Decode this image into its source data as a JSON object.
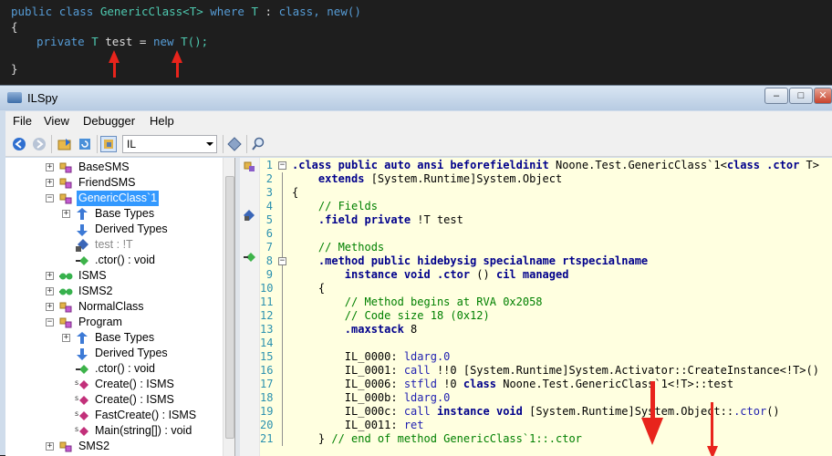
{
  "editor_snippet": {
    "line1": [
      "public",
      "class",
      "GenericClass<T>",
      "where",
      "T",
      ":",
      "class,",
      "new()"
    ],
    "line2": "{",
    "line3": [
      "private",
      "T",
      "test",
      "=",
      "new",
      "T();"
    ],
    "line4": "}"
  },
  "window": {
    "title": "ILSpy",
    "controls": [
      "–",
      "□",
      "✕"
    ]
  },
  "menu": {
    "file": "File",
    "view": "View",
    "debugger": "Debugger",
    "help": "Help"
  },
  "toolbar": {
    "language": "IL"
  },
  "tree": {
    "nodes": [
      {
        "label": "BaseSMS",
        "expander": "+",
        "icon": "class-icon"
      },
      {
        "label": "FriendSMS",
        "expander": "+",
        "icon": "class-icon"
      },
      {
        "label": "GenericClass`1",
        "expander": "−",
        "icon": "class-icon",
        "selected": true
      },
      {
        "label": "Base Types",
        "expander": "+",
        "icon": "base-types-icon"
      },
      {
        "label": "Derived Types",
        "expander": "",
        "icon": "derived-types-icon"
      },
      {
        "label": "test : !T",
        "expander": "",
        "icon": "field-icon",
        "gray": true
      },
      {
        "label": ".ctor() : void",
        "expander": "",
        "icon": "method-icon"
      },
      {
        "label": "ISMS",
        "expander": "+",
        "icon": "interface-icon"
      },
      {
        "label": "ISMS2",
        "expander": "+",
        "icon": "interface-icon"
      },
      {
        "label": "NormalClass",
        "expander": "+",
        "icon": "class-icon"
      },
      {
        "label": "Program",
        "expander": "−",
        "icon": "class-icon"
      },
      {
        "label": "Base Types",
        "expander": "+",
        "icon": "base-types-icon"
      },
      {
        "label": "Derived Types",
        "expander": "",
        "icon": "derived-types-icon"
      },
      {
        "label": ".ctor() : void",
        "expander": "",
        "icon": "method-icon"
      },
      {
        "label": "Create() : ISMS",
        "expander": "",
        "icon": "static-method-icon"
      },
      {
        "label": "Create() : ISMS",
        "expander": "",
        "icon": "static-method-icon"
      },
      {
        "label": "FastCreate() : ISMS",
        "expander": "",
        "icon": "static-method-icon"
      },
      {
        "label": "Main(string[]) : void",
        "expander": "",
        "icon": "static-method-icon"
      },
      {
        "label": "SMS2",
        "expander": "+",
        "icon": "class-icon"
      }
    ]
  },
  "code": {
    "lines": [
      {
        "n": "1",
        "parts": [
          [
            "k",
            ".class public auto ansi beforefieldinit "
          ],
          [
            "pl",
            "Noone.Test.GenericClass`1<"
          ],
          [
            "k",
            "class .ctor "
          ],
          [
            "pl",
            "T>"
          ]
        ]
      },
      {
        "n": "2",
        "parts": [
          [
            "pl",
            "    "
          ],
          [
            "k",
            "extends "
          ],
          [
            "pl",
            "[System.Runtime]System.Object"
          ]
        ]
      },
      {
        "n": "3",
        "parts": [
          [
            "pl",
            "{"
          ]
        ]
      },
      {
        "n": "4",
        "parts": [
          [
            "c",
            "    // Fields"
          ]
        ]
      },
      {
        "n": "5",
        "parts": [
          [
            "pl",
            "    "
          ],
          [
            "k",
            ".field private "
          ],
          [
            "pl",
            "!T test"
          ]
        ]
      },
      {
        "n": "6",
        "parts": [
          [
            "pl",
            ""
          ]
        ]
      },
      {
        "n": "7",
        "parts": [
          [
            "c",
            "    // Methods"
          ]
        ]
      },
      {
        "n": "8",
        "parts": [
          [
            "pl",
            "    "
          ],
          [
            "k",
            ".method public hidebysig specialname rtspecialname"
          ]
        ]
      },
      {
        "n": "9",
        "parts": [
          [
            "pl",
            "        "
          ],
          [
            "k",
            "instance void .ctor "
          ],
          [
            "pl",
            "() "
          ],
          [
            "k",
            "cil managed"
          ]
        ]
      },
      {
        "n": "10",
        "parts": [
          [
            "pl",
            "    {"
          ]
        ]
      },
      {
        "n": "11",
        "parts": [
          [
            "c",
            "        // Method begins at RVA 0x2058"
          ]
        ]
      },
      {
        "n": "12",
        "parts": [
          [
            "c",
            "        // Code size 18 (0x12)"
          ]
        ]
      },
      {
        "n": "13",
        "parts": [
          [
            "pl",
            "        "
          ],
          [
            "k",
            ".maxstack "
          ],
          [
            "pl",
            "8"
          ]
        ]
      },
      {
        "n": "14",
        "parts": [
          [
            "pl",
            ""
          ]
        ]
      },
      {
        "n": "15",
        "parts": [
          [
            "pl",
            "        IL_0000: "
          ],
          [
            "kb",
            "ldarg.0"
          ]
        ]
      },
      {
        "n": "16",
        "parts": [
          [
            "pl",
            "        IL_0001: "
          ],
          [
            "kb",
            "call "
          ],
          [
            "pl",
            "!!0 [System.Runtime]System.Activator::CreateInstance<!T>()"
          ]
        ]
      },
      {
        "n": "17",
        "parts": [
          [
            "pl",
            "        IL_0006: "
          ],
          [
            "kb",
            "stfld "
          ],
          [
            "pl",
            "!0 "
          ],
          [
            "k",
            "class "
          ],
          [
            "pl",
            "Noone.Test.GenericClass`1<!T>::test"
          ]
        ]
      },
      {
        "n": "18",
        "parts": [
          [
            "pl",
            "        IL_000b: "
          ],
          [
            "kb",
            "ldarg.0"
          ]
        ]
      },
      {
        "n": "19",
        "parts": [
          [
            "pl",
            "        IL_000c: "
          ],
          [
            "kb",
            "call "
          ],
          [
            "k",
            "instance void "
          ],
          [
            "pl",
            "[System.Runtime]System.Object::"
          ],
          [
            "kb",
            ".ctor"
          ],
          [
            "pl",
            "()"
          ]
        ]
      },
      {
        "n": "20",
        "parts": [
          [
            "pl",
            "        IL_0011: "
          ],
          [
            "kb",
            "ret"
          ]
        ]
      },
      {
        "n": "21",
        "parts": [
          [
            "pl",
            "    } "
          ],
          [
            "c",
            "// end of method GenericClass`1::.ctor"
          ]
        ]
      }
    ]
  },
  "colors": {
    "highlight_arrow": "#e8241c",
    "selection": "#3399ff",
    "code_background": "#ffffe0"
  }
}
